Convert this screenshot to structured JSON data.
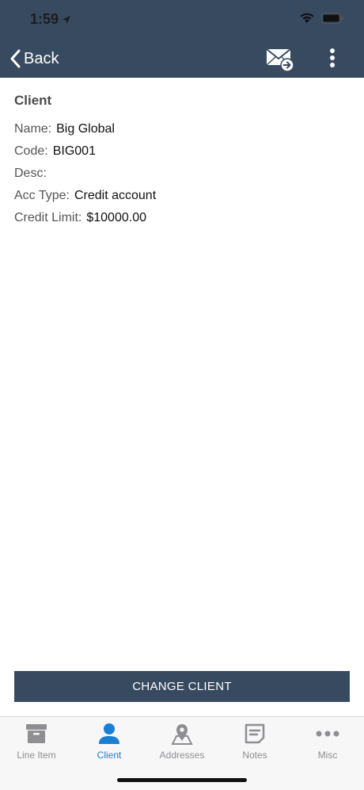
{
  "status_bar": {
    "time": "1:59"
  },
  "nav": {
    "back_label": "Back"
  },
  "client": {
    "section_title": "Client",
    "fields": [
      {
        "label": "Name:",
        "value": "Big Global"
      },
      {
        "label": "Code:",
        "value": "BIG001"
      },
      {
        "label": "Desc:",
        "value": ""
      },
      {
        "label": "Acc Type:",
        "value": "Credit account"
      },
      {
        "label": "Credit Limit:",
        "value": "$10000.00"
      }
    ]
  },
  "actions": {
    "change_client_label": "CHANGE CLIENT"
  },
  "tabs": [
    {
      "label": "Line Item",
      "icon": "archive-box-icon",
      "active": false
    },
    {
      "label": "Client",
      "icon": "person-icon",
      "active": true
    },
    {
      "label": "Addresses",
      "icon": "map-pin-icon",
      "active": false
    },
    {
      "label": "Notes",
      "icon": "note-icon",
      "active": false
    },
    {
      "label": "Misc",
      "icon": "more-horizontal-icon",
      "active": false
    }
  ],
  "colors": {
    "header_bg": "#384a60",
    "accent": "#1a7fd6",
    "inactive_tab": "#8e8e93"
  }
}
